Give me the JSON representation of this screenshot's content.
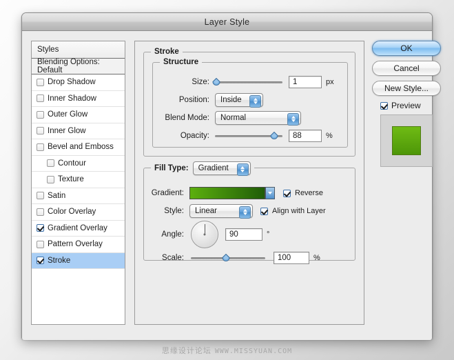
{
  "window": {
    "title": "Layer Style"
  },
  "styles_panel": {
    "header": "Styles",
    "blending_options": "Blending Options: Default",
    "items": [
      {
        "label": "Drop Shadow",
        "checked": false,
        "indent": false,
        "selected": false
      },
      {
        "label": "Inner Shadow",
        "checked": false,
        "indent": false,
        "selected": false
      },
      {
        "label": "Outer Glow",
        "checked": false,
        "indent": false,
        "selected": false
      },
      {
        "label": "Inner Glow",
        "checked": false,
        "indent": false,
        "selected": false
      },
      {
        "label": "Bevel and Emboss",
        "checked": false,
        "indent": false,
        "selected": false
      },
      {
        "label": "Contour",
        "checked": false,
        "indent": true,
        "selected": false
      },
      {
        "label": "Texture",
        "checked": false,
        "indent": true,
        "selected": false
      },
      {
        "label": "Satin",
        "checked": false,
        "indent": false,
        "selected": false
      },
      {
        "label": "Color Overlay",
        "checked": false,
        "indent": false,
        "selected": false
      },
      {
        "label": "Gradient Overlay",
        "checked": true,
        "indent": false,
        "selected": false
      },
      {
        "label": "Pattern Overlay",
        "checked": false,
        "indent": false,
        "selected": false
      },
      {
        "label": "Stroke",
        "checked": true,
        "indent": false,
        "selected": true
      }
    ]
  },
  "stroke": {
    "group_title": "Stroke",
    "structure": {
      "group_title": "Structure",
      "size_label": "Size:",
      "size_value": "1",
      "size_unit": "px",
      "size_percent": 2,
      "position_label": "Position:",
      "position_value": "Inside",
      "blend_mode_label": "Blend Mode:",
      "blend_mode_value": "Normal",
      "opacity_label": "Opacity:",
      "opacity_value": "88",
      "opacity_unit": "%",
      "opacity_percent": 88
    },
    "fill": {
      "fill_type_label": "Fill Type:",
      "fill_type_value": "Gradient",
      "gradient_label": "Gradient:",
      "gradient_start_color": "#5caf0e",
      "gradient_end_color": "#1f5c08",
      "reverse_label": "Reverse",
      "reverse_checked": true,
      "style_label": "Style:",
      "style_value": "Linear",
      "align_label": "Align with Layer",
      "align_checked": true,
      "angle_label": "Angle:",
      "angle_value": "90",
      "angle_unit": "°",
      "scale_label": "Scale:",
      "scale_value": "100",
      "scale_unit": "%",
      "scale_percent": 47
    }
  },
  "actions": {
    "ok_label": "OK",
    "cancel_label": "Cancel",
    "new_style_label": "New Style...",
    "preview_label": "Preview",
    "preview_checked": true,
    "preview_swatch_top": "#6fbb14",
    "preview_swatch_bottom": "#4d9608"
  },
  "watermark": {
    "text": "思缘设计论坛",
    "url": "WWW.MISSYUAN.COM"
  }
}
